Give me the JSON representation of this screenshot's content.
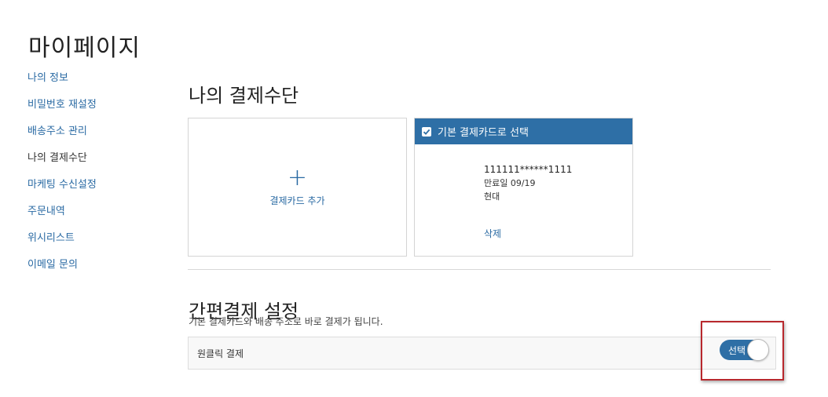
{
  "page": {
    "title": "마이페이지"
  },
  "sidebar": {
    "items": [
      {
        "label": "나의 정보",
        "active": false
      },
      {
        "label": "비밀번호 재설정",
        "active": false
      },
      {
        "label": "배송주소 관리",
        "active": false
      },
      {
        "label": "나의 결제수단",
        "active": true
      },
      {
        "label": "마케팅 수신설정",
        "active": false
      },
      {
        "label": "주문내역",
        "active": false
      },
      {
        "label": "위시리스트",
        "active": false
      },
      {
        "label": "이메일 문의",
        "active": false
      }
    ]
  },
  "payment": {
    "title": "나의 결제수단",
    "add_card": {
      "icon": "plus-icon",
      "label": "결제카드 추가"
    },
    "card": {
      "default_label": "기본 결제카드로 선택",
      "default_checked": true,
      "number": "111111******1111",
      "expiry": "만료일 09/19",
      "issuer": "현대",
      "delete_label": "삭제"
    }
  },
  "quick_pay": {
    "title": "간편결제 설정",
    "description": "기본 결제카드와 배송 주소로 바로 결제가 됩니다.",
    "option_label": "원클릭 결제",
    "toggle_label": "선택",
    "toggle_on": true
  },
  "colors": {
    "accent": "#2e6fa6",
    "link": "#2a6aa3",
    "highlight": "#b8282d"
  }
}
